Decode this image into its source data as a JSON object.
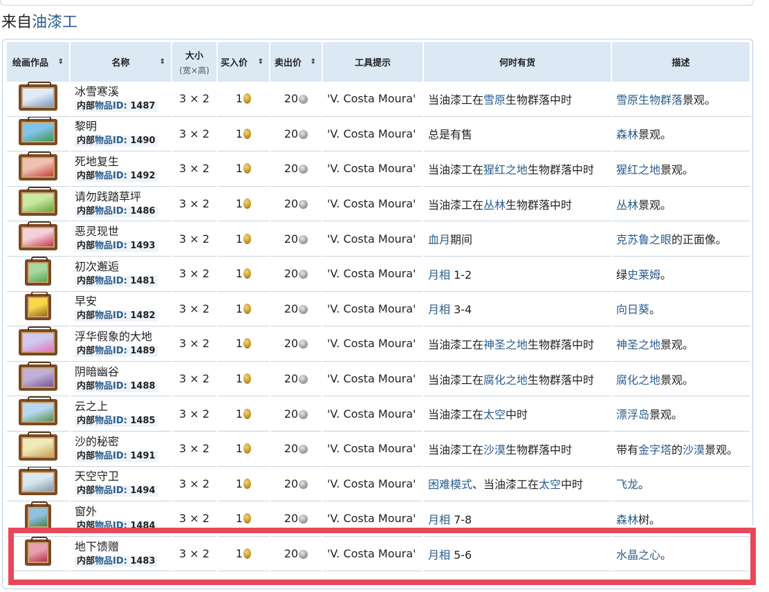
{
  "section": {
    "prefix": "来自",
    "vendor_link": "油漆工"
  },
  "headers": {
    "artwork": "绘画作品",
    "name": "名称",
    "size": "大小",
    "size_sub": "(宽×高)",
    "buy": "买入价",
    "sell": "卖出价",
    "tooltip": "工具提示",
    "availability": "何时有货",
    "description": "描述",
    "sort_icon": "⇕"
  },
  "id_label": {
    "inner": "内部",
    "item": "物品",
    "id": "ID:"
  },
  "rows": [
    {
      "name": "冰雪寒溪",
      "id": "1487",
      "size": "3 × 2",
      "buy": "1",
      "sell": "20",
      "tooltip": "'V. Costa Moura'",
      "avail": [
        {
          "t": "当油漆工在"
        },
        {
          "t": "雪原",
          "link": true
        },
        {
          "t": "生物群落中时"
        }
      ],
      "desc": [
        {
          "t": "雪原生物群落",
          "link": true
        },
        {
          "t": "景观。"
        }
      ],
      "art": [
        "#dfeaf5",
        "#6a8fbf"
      ]
    },
    {
      "name": "黎明",
      "id": "1490",
      "size": "3 × 2",
      "buy": "1",
      "sell": "20",
      "tooltip": "'V. Costa Moura'",
      "avail": [
        {
          "t": "总是有售"
        }
      ],
      "desc": [
        {
          "t": "森林",
          "link": true
        },
        {
          "t": "景观。"
        }
      ],
      "art": [
        "#7fc3e8",
        "#3c8f3e"
      ]
    },
    {
      "name": "死地复生",
      "id": "1492",
      "size": "3 × 2",
      "buy": "1",
      "sell": "20",
      "tooltip": "'V. Costa Moura'",
      "avail": [
        {
          "t": "当油漆工在"
        },
        {
          "t": "猩红之地",
          "link": true
        },
        {
          "t": "生物群落中时"
        }
      ],
      "desc": [
        {
          "t": "猩红之地",
          "link": true
        },
        {
          "t": "景观。"
        }
      ],
      "art": [
        "#f0c0b0",
        "#c0302a"
      ]
    },
    {
      "name": "请勿践踏草坪",
      "id": "1486",
      "size": "3 × 2",
      "buy": "1",
      "sell": "20",
      "tooltip": "'V. Costa Moura'",
      "avail": [
        {
          "t": "当油漆工在"
        },
        {
          "t": "丛林",
          "link": true
        },
        {
          "t": "生物群落中时"
        }
      ],
      "desc": [
        {
          "t": "丛林",
          "link": true
        },
        {
          "t": "景观。"
        }
      ],
      "art": [
        "#c8e8a0",
        "#5a9a2a"
      ]
    },
    {
      "name": "恶灵现世",
      "id": "1493",
      "size": "3 × 2",
      "buy": "1",
      "sell": "20",
      "tooltip": "'V. Costa Moura'",
      "avail": [
        {
          "t": "血月",
          "link": true
        },
        {
          "t": "期间"
        }
      ],
      "desc": [
        {
          "t": "克苏鲁之眼",
          "link": true
        },
        {
          "t": "的正面像。"
        }
      ],
      "art": [
        "#f4d0d8",
        "#c02040"
      ]
    },
    {
      "name": "初次邂逅",
      "id": "1481",
      "size": "3 × 2",
      "buy": "1",
      "sell": "20",
      "tooltip": "'V. Costa Moura'",
      "avail": [
        {
          "t": "月相",
          "link": true
        },
        {
          "t": " 1-2"
        }
      ],
      "desc": [
        {
          "t": "绿"
        },
        {
          "t": "史莱姆",
          "link": true
        },
        {
          "t": "。"
        }
      ],
      "art": [
        "#a8d8a0",
        "#4aa040"
      ],
      "tall": true
    },
    {
      "name": "早安",
      "id": "1482",
      "size": "3 × 2",
      "buy": "1",
      "sell": "20",
      "tooltip": "'V. Costa Moura'",
      "avail": [
        {
          "t": "月相",
          "link": true
        },
        {
          "t": " 3-4"
        }
      ],
      "desc": [
        {
          "t": "向日葵",
          "link": true
        },
        {
          "t": "。"
        }
      ],
      "art": [
        "#f8d848",
        "#8a5a10"
      ],
      "tall": true
    },
    {
      "name": "浮华假象的大地",
      "id": "1489",
      "size": "3 × 2",
      "buy": "1",
      "sell": "20",
      "tooltip": "'V. Costa Moura'",
      "avail": [
        {
          "t": "当油漆工在"
        },
        {
          "t": "神圣之地",
          "link": true
        },
        {
          "t": "生物群落中时"
        }
      ],
      "desc": [
        {
          "t": "神圣之地",
          "link": true
        },
        {
          "t": "景观。"
        }
      ],
      "art": [
        "#d0c8f0",
        "#e070b0"
      ]
    },
    {
      "name": "阴暗幽谷",
      "id": "1488",
      "size": "3 × 2",
      "buy": "1",
      "sell": "20",
      "tooltip": "'V. Costa Moura'",
      "avail": [
        {
          "t": "当油漆工在"
        },
        {
          "t": "腐化之地",
          "link": true
        },
        {
          "t": "生物群落中时"
        }
      ],
      "desc": [
        {
          "t": "腐化之地",
          "link": true
        },
        {
          "t": "景观。"
        }
      ],
      "art": [
        "#c0b0d8",
        "#6a4a90"
      ]
    },
    {
      "name": "云之上",
      "id": "1485",
      "size": "3 × 2",
      "buy": "1",
      "sell": "20",
      "tooltip": "'V. Costa Moura'",
      "avail": [
        {
          "t": "当油漆工在"
        },
        {
          "t": "太空",
          "link": true
        },
        {
          "t": "中时"
        }
      ],
      "desc": [
        {
          "t": "漂浮岛",
          "link": true
        },
        {
          "t": "景观。"
        }
      ],
      "art": [
        "#b8d8f0",
        "#4a8a3a"
      ]
    },
    {
      "name": "沙的秘密",
      "id": "1491",
      "size": "3 × 2",
      "buy": "1",
      "sell": "20",
      "tooltip": "'V. Costa Moura'",
      "avail": [
        {
          "t": "当油漆工在"
        },
        {
          "t": "沙漠",
          "link": true
        },
        {
          "t": "生物群落中时"
        }
      ],
      "desc": [
        {
          "t": "带有"
        },
        {
          "t": "金字塔",
          "link": true
        },
        {
          "t": "的"
        },
        {
          "t": "沙漠",
          "link": true
        },
        {
          "t": "景观。"
        }
      ],
      "art": [
        "#f0e8b8",
        "#c89a48"
      ]
    },
    {
      "name": "天空守卫",
      "id": "1494",
      "size": "3 × 2",
      "buy": "1",
      "sell": "20",
      "tooltip": "'V. Costa Moura'",
      "avail": [
        {
          "t": "困难模式",
          "link": true
        },
        {
          "t": "、当油漆工在"
        },
        {
          "t": "太空",
          "link": true
        },
        {
          "t": "中时"
        }
      ],
      "desc": [
        {
          "t": "飞龙",
          "link": true
        },
        {
          "t": "。"
        }
      ],
      "art": [
        "#d8e8f0",
        "#7a8ea0"
      ]
    },
    {
      "name": "窗外",
      "id": "1484",
      "size": "3 × 2",
      "buy": "1",
      "sell": "20",
      "tooltip": "'V. Costa Moura'",
      "avail": [
        {
          "t": "月相",
          "link": true
        },
        {
          "t": " 7-8"
        }
      ],
      "desc": [
        {
          "t": "森林",
          "link": true
        },
        {
          "t": "树。"
        }
      ],
      "art": [
        "#90c0e0",
        "#3a7a3a"
      ],
      "tall": true
    },
    {
      "name": "地下馈赠",
      "id": "1483",
      "size": "3 × 2",
      "buy": "1",
      "sell": "20",
      "tooltip": "'V. Costa Moura'",
      "avail": [
        {
          "t": "月相",
          "link": true
        },
        {
          "t": " 5-6"
        }
      ],
      "desc": [
        {
          "t": "水晶之心",
          "link": true
        },
        {
          "t": "。"
        }
      ],
      "art": [
        "#e8a0b0",
        "#b02040"
      ],
      "tall": true
    }
  ]
}
